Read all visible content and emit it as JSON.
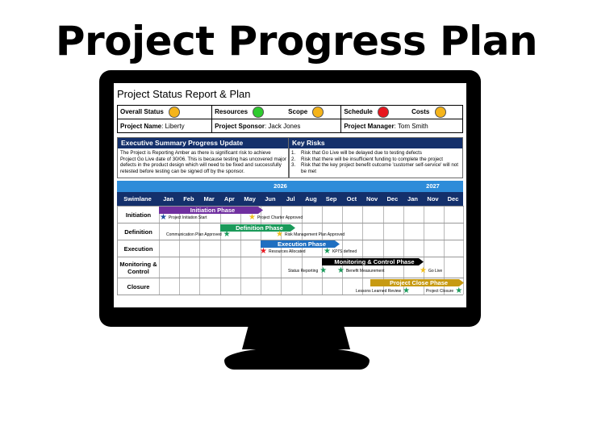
{
  "title": "Project Progress Plan",
  "report": {
    "title": "Project Status Report & Plan",
    "status_row": {
      "overall_label": "Overall Status",
      "resources_label": "Resources",
      "scope_label": "Scope",
      "schedule_label": "Schedule",
      "costs_label": "Costs"
    },
    "status_colors": {
      "overall": "#f5b41a",
      "resources": "#2ecc2e",
      "scope": "#f5b41a",
      "schedule": "#e8161e",
      "costs": "#f5b41a"
    },
    "info_row": {
      "name_label": "Project Name",
      "name_value": "Liberty",
      "sponsor_label": "Project Sponsor",
      "sponsor_value": "Jack Jones",
      "manager_label": "Project Manager",
      "manager_value": "Tom Smith"
    },
    "summary": {
      "heading": "Executive Summary Progress Update",
      "text": "The Project is Reporting Amber as there is significant risk to achieve Project Go Live date of 30/06. This is because testing has uncovered major defects in the product design which will need to be fixed and successfully retested before testing can be signed off by the sponsor."
    },
    "risks": {
      "heading": "Key Risks",
      "items": [
        {
          "num": "1.",
          "text": "Risk that Go Live will be delayed due to testing defects"
        },
        {
          "num": "2.",
          "text": "Risk that there will be insufficient funding to complete the project"
        },
        {
          "num": "3.",
          "text": "Risk that the key project benefit outcome 'customer self-service' will not be met"
        }
      ]
    }
  },
  "gantt": {
    "years": [
      "2026",
      "2027"
    ],
    "swimlane_label": "Swimlane",
    "months": [
      "Jan",
      "Feb",
      "Mar",
      "Apr",
      "May",
      "Jun",
      "Jul",
      "Aug",
      "Sep",
      "Oct",
      "Nov",
      "Dec",
      "Jan",
      "Nov",
      "Dec"
    ],
    "lanes": [
      {
        "label": "Initiation"
      },
      {
        "label": "Definition"
      },
      {
        "label": "Execution"
      },
      {
        "label": "Monitoring & Control"
      },
      {
        "label": "Closure"
      }
    ],
    "phases": [
      {
        "label": "Initiation Phase",
        "color": "#7030a0"
      },
      {
        "label": "Definition Phase",
        "color": "#1a9a5a"
      },
      {
        "label": "Execution Phase",
        "color": "#1f6fc1"
      },
      {
        "label": "Monitoring & Control Phase",
        "color": "#000000"
      },
      {
        "label": "Project Close Phase",
        "color": "#c79a12"
      }
    ],
    "milestones": [
      {
        "label": "Project Initiation Start",
        "color": "#1f4fa0"
      },
      {
        "label": "Project Charter Approved",
        "color": "#f0c020"
      },
      {
        "label": "Communication Plan Approved",
        "color": "#1a9a5a"
      },
      {
        "label": "Risk Management Plan Approved",
        "color": "#f0c020"
      },
      {
        "label": "Resources Allocated",
        "color": "#e8161e"
      },
      {
        "label": "KPI'S defined",
        "color": "#1a9a5a"
      },
      {
        "label": "Status Reporting",
        "color": "#1a9a5a"
      },
      {
        "label": "Benefit Measurement",
        "color": "#1a9a5a"
      },
      {
        "label": "Go Live",
        "color": "#f0c020"
      },
      {
        "label": "Lessons Learned Review",
        "color": "#1a9a5a"
      },
      {
        "label": "Project Closure",
        "color": "#1a9a5a"
      }
    ]
  }
}
